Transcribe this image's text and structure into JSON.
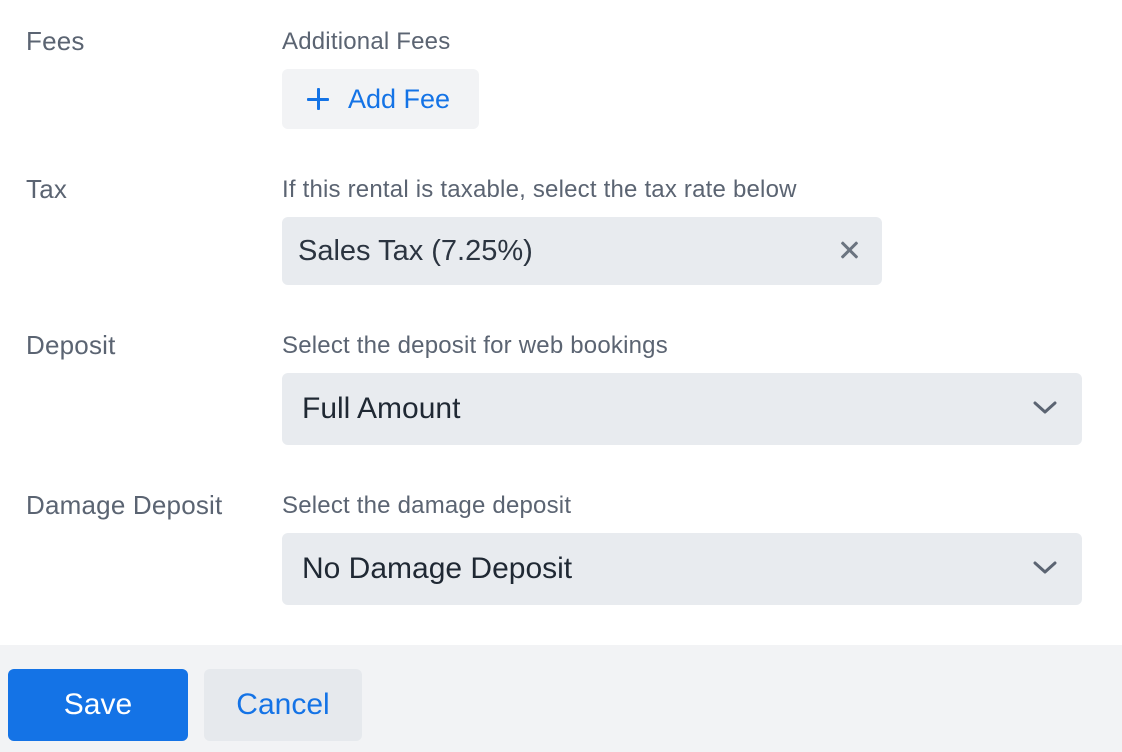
{
  "fees": {
    "label": "Fees",
    "help": "Additional Fees",
    "add_button": {
      "icon": "plus-icon",
      "label": "Add Fee"
    }
  },
  "tax": {
    "label": "Tax",
    "help": "If this rental is taxable, select the tax rate below",
    "selected": "Sales Tax (7.25%)",
    "clear_icon": "close-icon"
  },
  "deposit": {
    "label": "Deposit",
    "help": "Select the deposit for web bookings",
    "selected": "Full Amount",
    "dropdown_icon": "chevron-down-icon"
  },
  "damage_deposit": {
    "label": "Damage Deposit",
    "help": "Select the damage deposit",
    "selected": "No Damage Deposit",
    "dropdown_icon": "chevron-down-icon"
  },
  "footer": {
    "save_label": "Save",
    "cancel_label": "Cancel"
  },
  "colors": {
    "accent": "#1473e6",
    "field_bg": "#e8ebef",
    "label_text": "#5b6472",
    "footer_bg": "#f2f3f5"
  }
}
